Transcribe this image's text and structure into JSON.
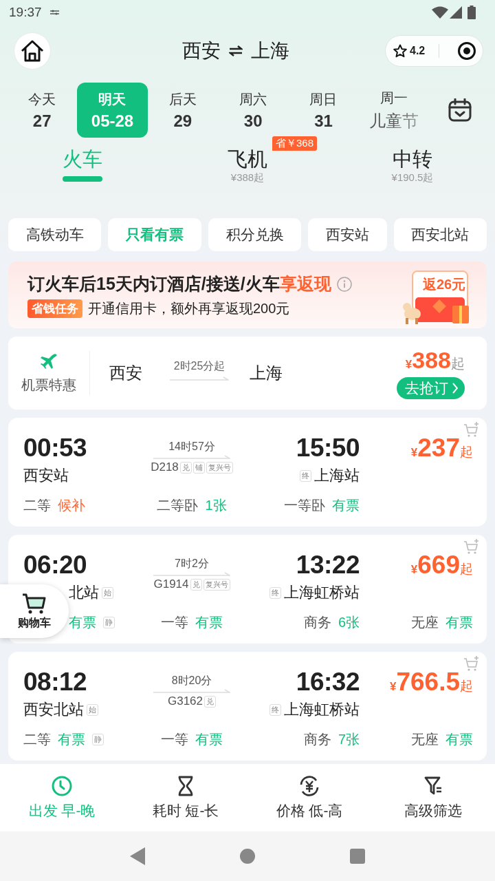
{
  "status_bar": {
    "time": "19:37"
  },
  "header": {
    "from": "西安",
    "to": "上海",
    "rating": "4.2"
  },
  "dates": [
    {
      "label": "今天",
      "date": "27",
      "selected": false
    },
    {
      "label": "明天",
      "date": "05-28",
      "selected": true
    },
    {
      "label": "后天",
      "date": "29",
      "selected": false
    },
    {
      "label": "周六",
      "date": "30",
      "selected": false
    },
    {
      "label": "周日",
      "date": "31",
      "selected": false
    },
    {
      "label": "周一",
      "date": "儿童节",
      "selected": false
    }
  ],
  "modes": [
    {
      "label": "火车",
      "selected": true
    },
    {
      "label": "飞机",
      "price": "¥388起",
      "badge": "省￥368",
      "selected": false
    },
    {
      "label": "中转",
      "price": "¥190.5起",
      "selected": false
    }
  ],
  "filters": [
    {
      "label": "高铁动车",
      "selected": false
    },
    {
      "label": "只看有票",
      "selected": true
    },
    {
      "label": "积分兑换",
      "selected": false
    },
    {
      "label": "西安站",
      "selected": false
    },
    {
      "label": "西安北站",
      "selected": false
    }
  ],
  "promo": {
    "title": "订火车后15天内订酒店/接送/火车",
    "highlight": "享返现",
    "tag": "省钱任务",
    "text": "开通信用卡，额外再享返现200元",
    "reward": "返26元"
  },
  "flight_deal": {
    "label": "机票特惠",
    "from": "西安",
    "duration": "2时25分起",
    "to": "上海",
    "currency": "¥",
    "price": "388",
    "suffix": "起",
    "button": "去抢订"
  },
  "trains": [
    {
      "dep_time": "00:53",
      "dep_station": "西安站",
      "duration": "14时57分",
      "number": "D218",
      "number_tags": [
        "兑",
        "铺",
        "复兴号"
      ],
      "arr_time": "15:50",
      "arr_tag": "终",
      "arr_station": "上海站",
      "currency": "¥",
      "price": "237",
      "suffix": "起",
      "seats": [
        {
          "class": "二等",
          "status": "候补",
          "kind": "waitlist"
        },
        {
          "class": "二等卧",
          "status": "1张",
          "kind": "available"
        },
        {
          "class": "一等卧",
          "status": "有票",
          "kind": "available"
        }
      ]
    },
    {
      "dep_time": "06:20",
      "dep_station": "北站",
      "dep_tag": "始",
      "duration": "7时2分",
      "number": "G1914",
      "number_tags": [
        "兑",
        "复兴号"
      ],
      "arr_time": "13:22",
      "arr_tag": "终",
      "arr_station": "上海虹桥站",
      "currency": "¥",
      "price": "669",
      "suffix": "起",
      "cart_label": "购物车",
      "seats": [
        {
          "status": "有票",
          "kind": "available",
          "tag": "静"
        },
        {
          "class": "一等",
          "status": "有票",
          "kind": "available"
        },
        {
          "class": "商务",
          "status": "6张",
          "kind": "available"
        },
        {
          "class": "无座",
          "status": "有票",
          "kind": "available"
        }
      ]
    },
    {
      "dep_time": "08:12",
      "dep_station": "西安北站",
      "dep_tag": "始",
      "duration": "8时20分",
      "number": "G3162",
      "number_tags": [
        "兑"
      ],
      "arr_time": "16:32",
      "arr_tag": "终",
      "arr_station": "上海虹桥站",
      "currency": "¥",
      "price": "766.5",
      "suffix": "起",
      "seats": [
        {
          "class": "二等",
          "status": "有票",
          "kind": "available",
          "tag": "静"
        },
        {
          "class": "一等",
          "status": "有票",
          "kind": "available"
        },
        {
          "class": "商务",
          "status": "7张",
          "kind": "available"
        },
        {
          "class": "无座",
          "status": "有票",
          "kind": "available"
        }
      ]
    }
  ],
  "sort_bar": [
    {
      "label": "出发 早-晚",
      "selected": true
    },
    {
      "label": "耗时 短-长",
      "selected": false
    },
    {
      "label": "价格 低-高",
      "selected": false
    },
    {
      "label": "高级筛选",
      "selected": false
    }
  ]
}
